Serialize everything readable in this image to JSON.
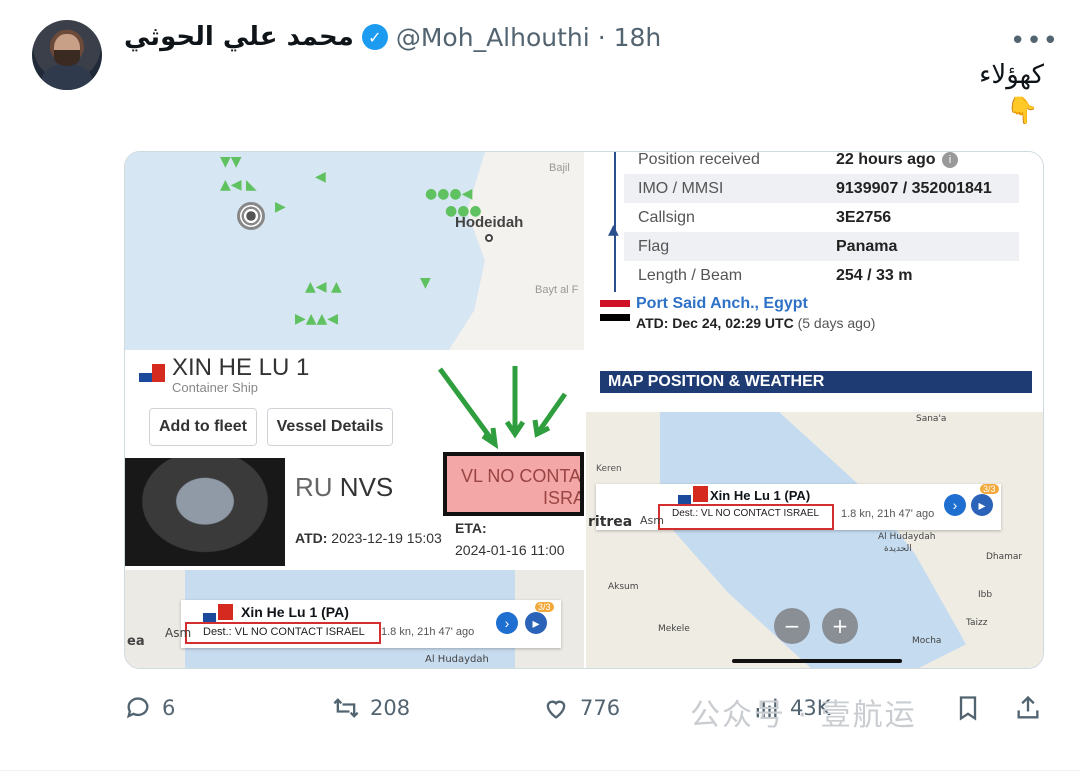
{
  "tweet": {
    "author_name": "محمد علي الحوثي",
    "handle": "@Moh_Alhouthi",
    "time": "· 18h",
    "more": "•••",
    "text": "كهؤلاء",
    "emoji": "👇"
  },
  "image_left": {
    "map_labels": {
      "hodeidah": "Hodeidah",
      "bajil": "Bajil",
      "bayt": "Bayt al F"
    },
    "vessel_name": "XIN HE LU 1",
    "vessel_type": "Container Ship",
    "add_to_fleet": "Add to fleet",
    "vessel_details": "Vessel Details",
    "port_code": "RU",
    "port_name": "NVS",
    "atd_label": "ATD:",
    "atd_value": "2023-12-19 15:03",
    "eta_label": "ETA:",
    "eta_value": "2024-01-16 11:00",
    "dest_text_1": "VL NO CONTAC",
    "dest_text_2": "ISRA",
    "bottom_vessel": "Xin He Lu 1 (PA)",
    "bottom_dest": "Dest.: VL NO CONTACT ISRAEL",
    "bottom_speed": "1.8 kn, 21h 47' ago",
    "bottom_badge": "3/3",
    "bottom_city_1": "Asm",
    "bottom_city_2": "ea",
    "bottom_city_3": "Al Hudaydah"
  },
  "image_right": {
    "rows": [
      {
        "k": "Position received",
        "v": "22 hours ago"
      },
      {
        "k": "IMO / MMSI",
        "v": "9139907 / 352001841"
      },
      {
        "k": "Callsign",
        "v": "3E2756"
      },
      {
        "k": "Flag",
        "v": "Panama"
      },
      {
        "k": "Length / Beam",
        "v": "254 / 33 m"
      }
    ],
    "port": "Port Said Anch., Egypt",
    "atd": "ATD: Dec 24, 02:29 UTC",
    "atd_ago": "(5 days ago)",
    "map_header": "MAP POSITION & WEATHER",
    "vessel": "Xin He Lu 1 (PA)",
    "dest": "Dest.: VL NO CONTACT ISRAEL",
    "speed": "1.8 kn, 21h 47' ago",
    "badge": "3/3",
    "labels": {
      "eritrea": "ritrea",
      "asm": "Asm",
      "kere": "Keren",
      "hudaydah": "Al Hudaydah",
      "hudaydah_ar": "الحديدة",
      "dhamar": "Dhamar",
      "ibb": "Ibb",
      "taizz": "Taizz",
      "mokha": "Mocha",
      "mekele": "Mekele",
      "aksum": "Aksum",
      "sanaa": "Sana'a"
    }
  },
  "actions": {
    "reply": "6",
    "retweet": "208",
    "like": "776",
    "views": "43K"
  },
  "watermark": "公众号 · 壹航运"
}
